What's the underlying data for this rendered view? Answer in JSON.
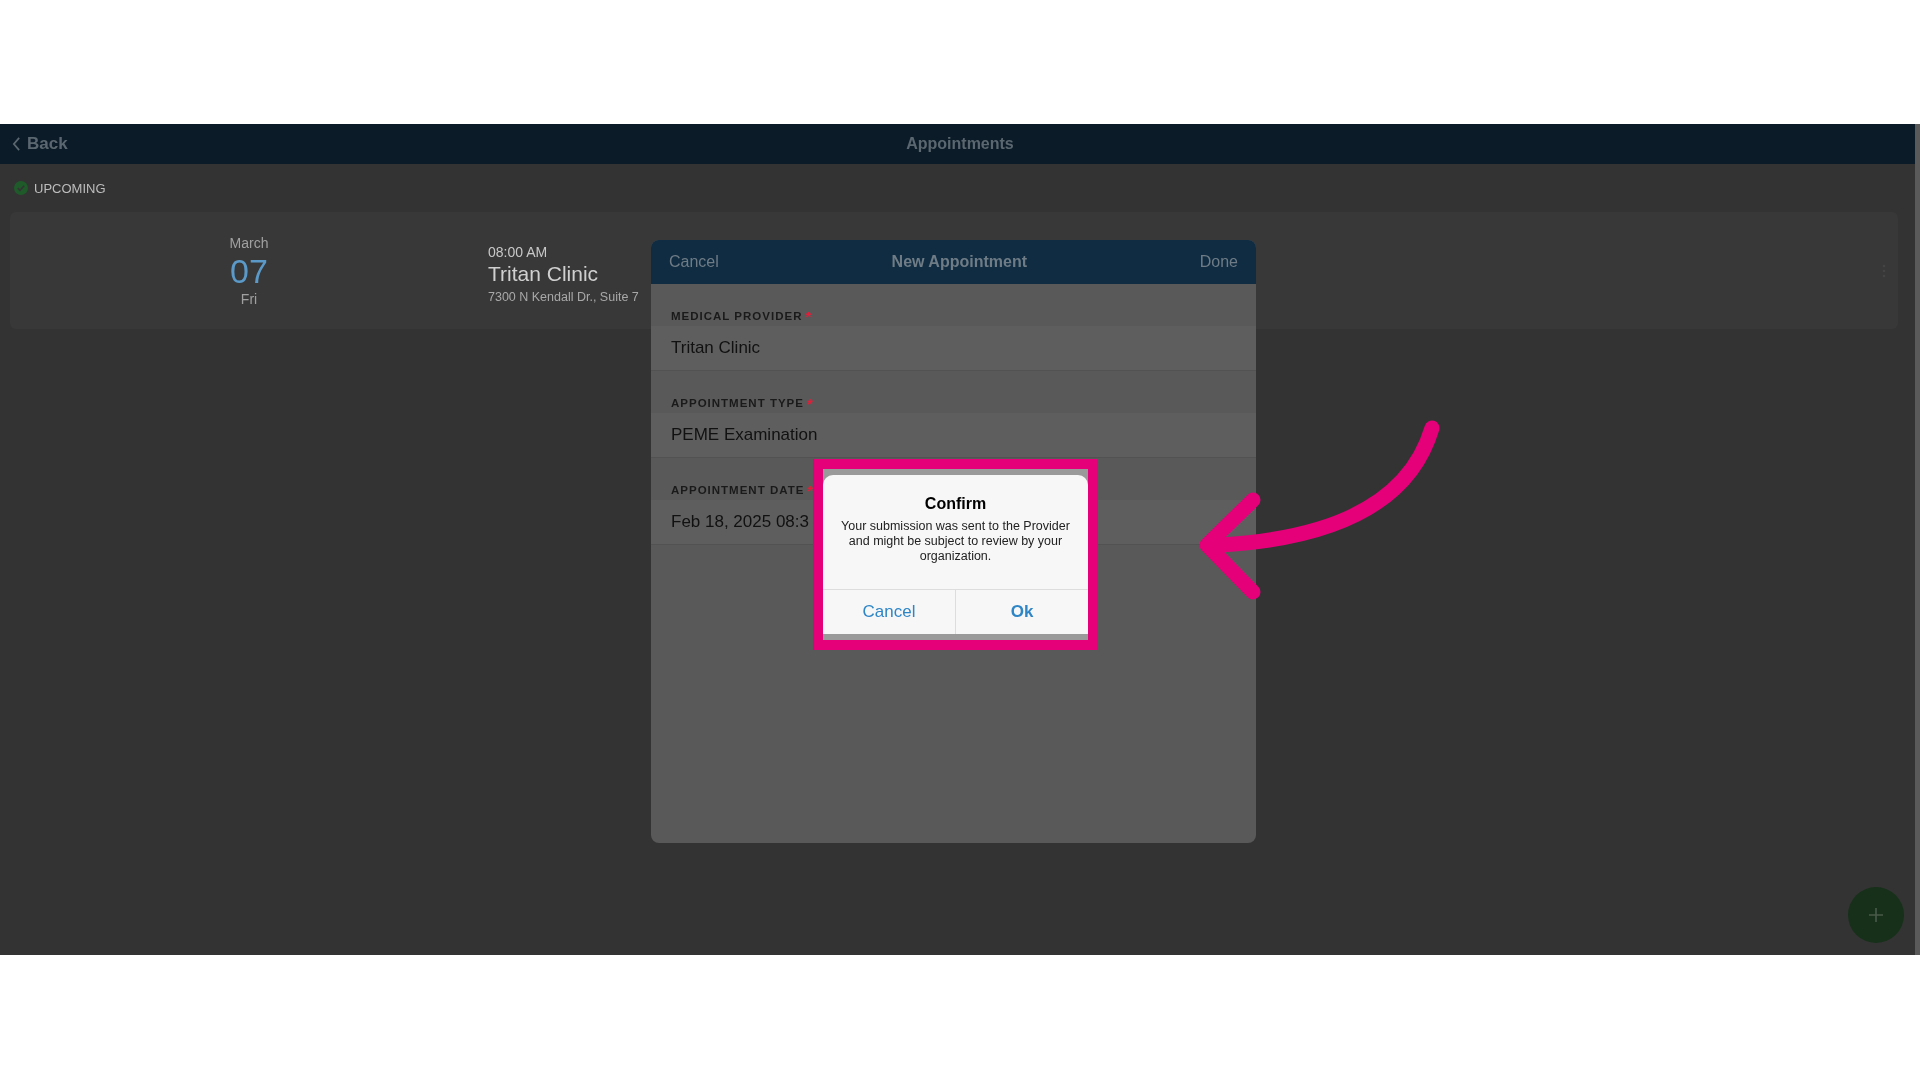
{
  "nav": {
    "back": "Back",
    "title": "Appointments"
  },
  "section": {
    "label": "UPCOMING"
  },
  "appointments": [
    {
      "month": "March",
      "day": "07",
      "weekday": "Fri",
      "time": "08:00 AM",
      "provider": "Tritan Clinic",
      "address": "7300 N Kendall Dr., Suite 7"
    }
  ],
  "modal": {
    "cancel": "Cancel",
    "title": "New Appointment",
    "done": "Done",
    "fields": [
      {
        "label": "MEDICAL PROVIDER",
        "mark": "*",
        "value": "Tritan Clinic"
      },
      {
        "label": "APPOINTMENT TYPE",
        "mark": "*",
        "value": "PEME Examination"
      },
      {
        "label": "APPOINTMENT DATE",
        "mark": "*",
        "value": "Feb 18, 2025 08:3"
      }
    ]
  },
  "dialog": {
    "title": "Confirm",
    "message": "Your submission was sent to the Provider and might be subject to review by your organization.",
    "buttons": [
      {
        "label": "Cancel",
        "kind": "normal"
      },
      {
        "label": "Ok",
        "kind": "primary"
      }
    ]
  }
}
